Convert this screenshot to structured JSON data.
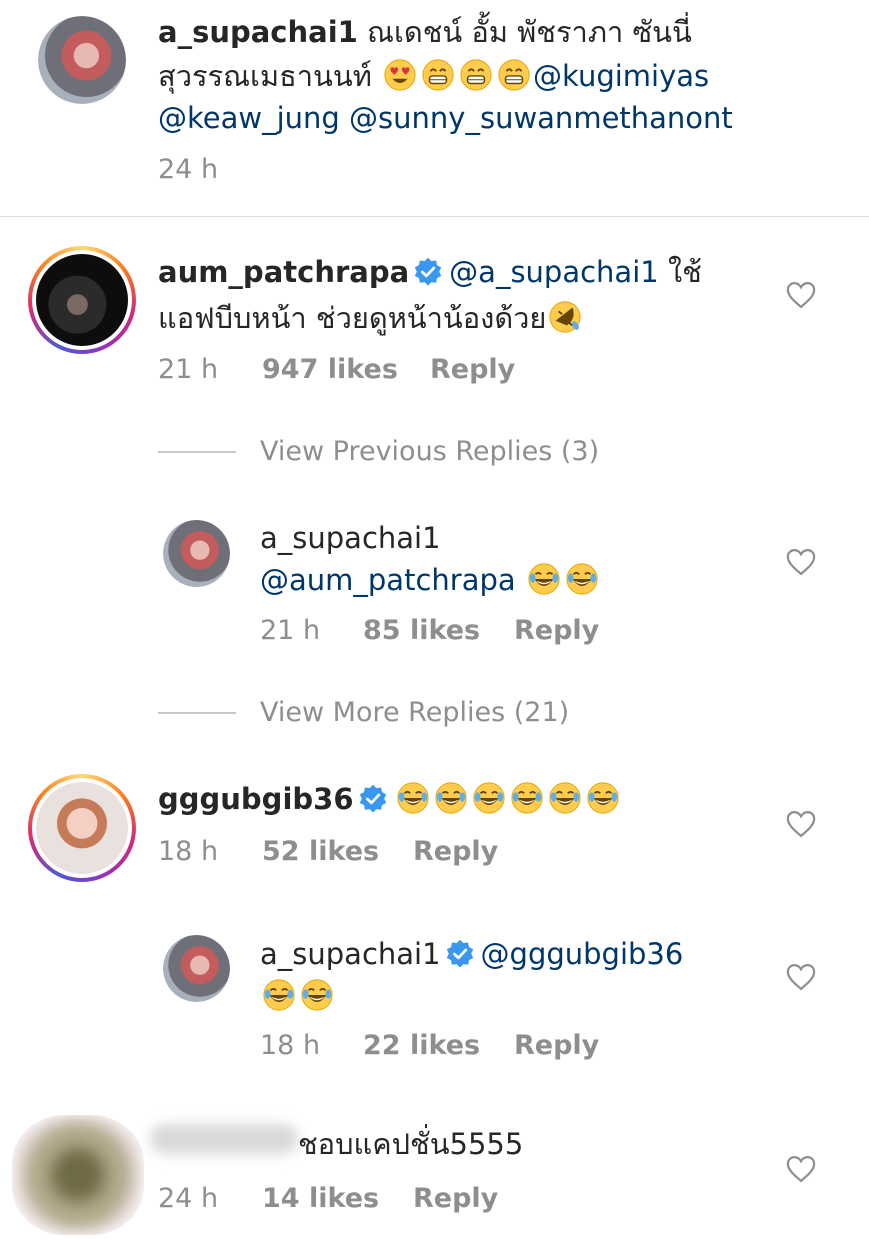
{
  "caption": {
    "username": "a_supachai1",
    "text_line1": "ณเดชน์ อั้ม พัชราภา ซันนี่",
    "text_line2": "สุวรรณเมธานนท์",
    "mention1": "@kugimiyas",
    "mention2": "@keaw_jung",
    "mention3": "@sunny_suwanmethanont",
    "time": "24 h"
  },
  "comments": [
    {
      "username": "aum_patchrapa",
      "verified": true,
      "mention": "@a_supachai1",
      "text_line1_suffix": "ใช้",
      "text_line2": "แอฟบีบหน้า ช่วยดูหน้าน้องด้วย",
      "time": "21 h",
      "likes": "947 likes",
      "reply": "Reply"
    },
    {
      "view_previous": "View Previous Replies (3)"
    },
    {
      "username": "a_supachai1",
      "mention": "@aum_patchrapa",
      "time": "21 h",
      "likes": "85 likes",
      "reply": "Reply"
    },
    {
      "view_more": "View More Replies (21)"
    },
    {
      "username": "gggubgib36",
      "verified": true,
      "time": "18 h",
      "likes": "52 likes",
      "reply": "Reply"
    },
    {
      "username": "a_supachai1",
      "verified": true,
      "mention": "@gggubgib36",
      "time": "18 h",
      "likes": "22 likes",
      "reply": "Reply"
    },
    {
      "text": "ชอบแคปชั่น5555",
      "time": "24 h",
      "likes": "14 likes",
      "reply": "Reply"
    }
  ],
  "colors": {
    "mention": "#00376b",
    "meta": "#8e8e8e",
    "verified": "#3897f0"
  },
  "icons": [
    "heart-icon",
    "verified-icon",
    "laughing-emoji",
    "heart-eyes-emoji",
    "grinning-emoji",
    "rofl-emoji"
  ]
}
